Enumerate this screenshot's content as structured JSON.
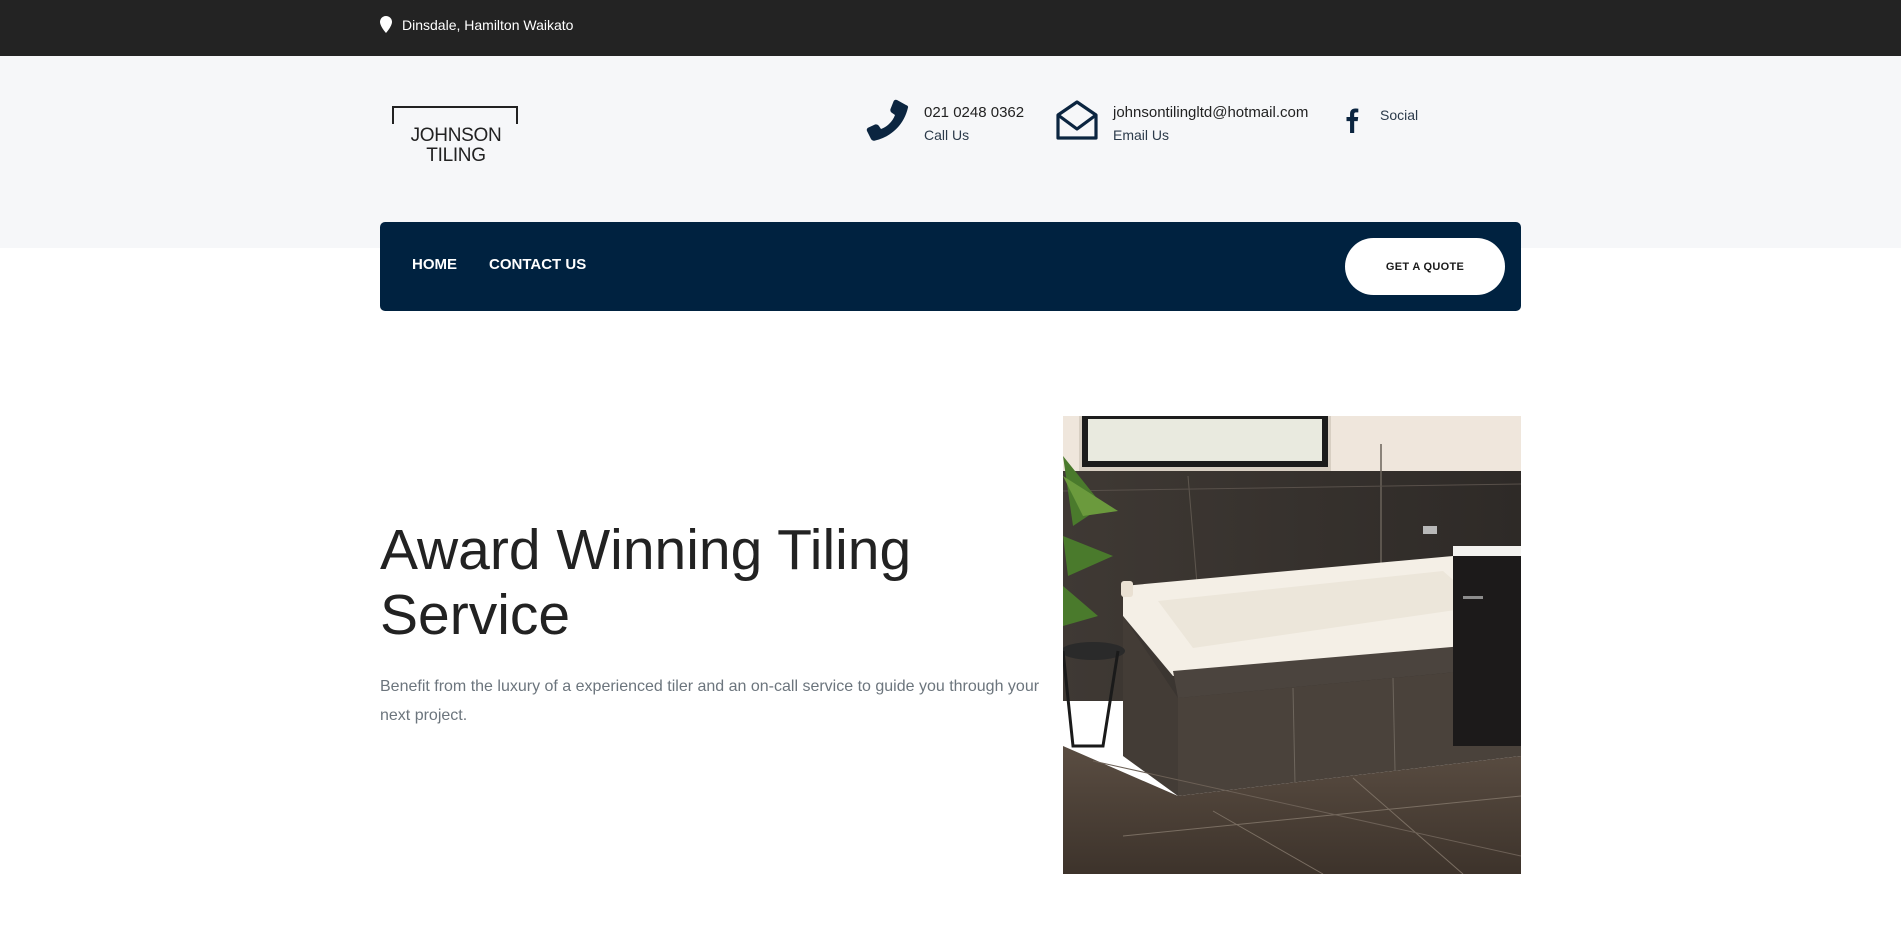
{
  "topbar": {
    "location": "Dinsdale, Hamilton Waikato",
    "location_icon": "map-pin-icon"
  },
  "header": {
    "logo_text": "JOHNSON TILING",
    "phone": {
      "value": "021 0248 0362",
      "label": "Call Us",
      "icon": "phone-icon"
    },
    "email": {
      "value": "johnsontilingltd@hotmail.com",
      "label": "Email Us",
      "icon": "envelope-icon"
    },
    "social": {
      "label": "Social",
      "icon": "facebook-icon"
    }
  },
  "nav": {
    "items": [
      {
        "label": "HOME"
      },
      {
        "label": "CONTACT US"
      }
    ],
    "cta": "GET A QUOTE"
  },
  "hero": {
    "title": "Award Winning Tiling Service",
    "text": "Benefit from the luxury of a experienced tiler and an on-call service to guide you through your next project."
  },
  "colors": {
    "topbar_bg": "#232323",
    "header_bg": "#f6f7f9",
    "nav_bg": "#002240",
    "accent_navy": "#0b2540"
  }
}
